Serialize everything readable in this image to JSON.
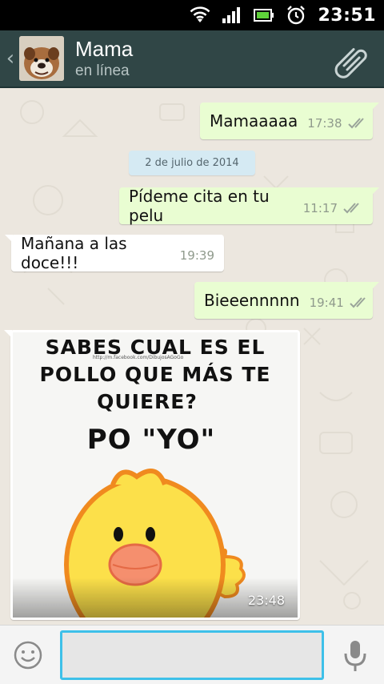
{
  "status_bar": {
    "time": "23:51",
    "icons": [
      "wifi-icon",
      "signal-icon",
      "battery-icon",
      "alarm-icon"
    ]
  },
  "header": {
    "contact_name": "Mama",
    "contact_status": "en línea",
    "back_icon": "chevron-left-icon",
    "attach_icon": "paperclip-icon",
    "bg_color": "#304646"
  },
  "chat": {
    "bg_color": "#ece7df",
    "date_separator": "2 de julio de 2014",
    "messages": [
      {
        "direction": "out",
        "text": "Mamaaaaa",
        "time": "17:38",
        "status_icon": "double-check-icon"
      },
      {
        "direction": "out",
        "text": "Pídeme cita en tu pelu",
        "time": "11:17",
        "status_icon": "double-check-icon"
      },
      {
        "direction": "in",
        "text": "Mañana a las doce!!!",
        "time": "19:39"
      },
      {
        "direction": "out",
        "text": "Bieeennnnn",
        "time": "19:41",
        "status_icon": "double-check-icon"
      }
    ],
    "image_message": {
      "direction": "in",
      "time": "23:48",
      "lines": [
        "SABES CUAL ES EL",
        "POLLO QUE MÁS TE",
        "QUIERE?",
        "PO \"YO\""
      ],
      "watermark": "http://m.facebook.com/DibujosAGoGo"
    },
    "outgoing_bubble_color": "#e9fdd2"
  },
  "input_bar": {
    "placeholder": "",
    "value": "",
    "emoji_icon": "smiley-icon",
    "mic_icon": "microphone-icon",
    "focus_color": "#3ec0e9"
  }
}
